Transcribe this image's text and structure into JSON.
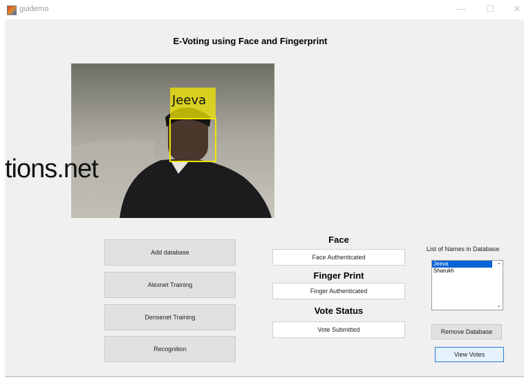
{
  "window": {
    "title": "guidemo",
    "minimize_glyph": "—",
    "maximize_glyph": "☐",
    "close_glyph": "✕"
  },
  "app": {
    "heading": "E-Voting using Face and Fingerprint"
  },
  "camera": {
    "detected_name": "Jeeva",
    "watermark": "tions.net",
    "box_color": "#f2e600"
  },
  "buttons": {
    "add_database": "Add database",
    "alexnet_training": "Alexnet Training",
    "densenet_training": "Densenet Training",
    "recognition": "Recognition",
    "remove_database": "Remove Database",
    "view_votes": "View Votes"
  },
  "status": {
    "face_label": "Face",
    "face_value": "Face Authenticated",
    "finger_label": "Finger Print",
    "finger_value": "Finger Authenticated",
    "vote_label": "Vote Status",
    "vote_value": "Vote Submitted"
  },
  "database": {
    "label": "List of Names  in Database",
    "names": [
      "Jeeva",
      "Sharukh"
    ],
    "selected": "Jeeva"
  },
  "colors": {
    "selection": "#0a64d8",
    "panel": "#f0f0f0",
    "button": "#e1e1e1"
  }
}
